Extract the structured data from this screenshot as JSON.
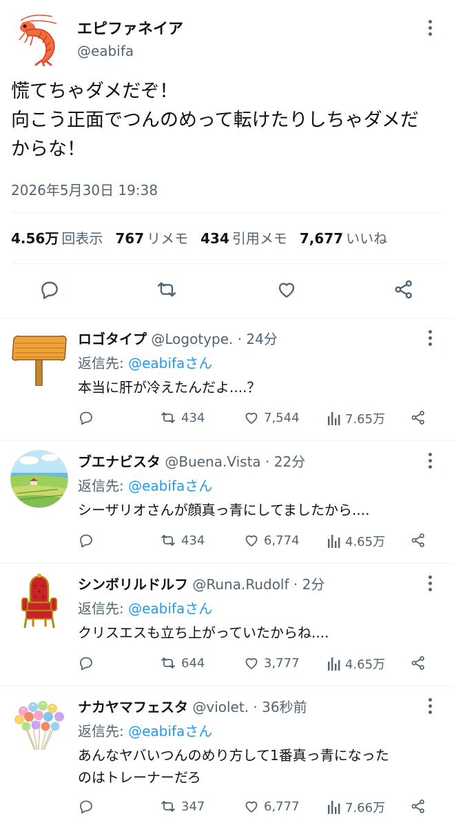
{
  "main_tweet": {
    "author_name": "エピファネイア",
    "author_handle": "@eabifa",
    "text_lines": [
      "慌てちゃダメだぞ！",
      "向こう正面でつんのめって転けたりしちゃダメだ",
      "からな！"
    ],
    "timestamp": "2026年5月30日 19:38",
    "stats": {
      "views_value": "4.56万",
      "views_label": "回表示",
      "reposts_value": "767",
      "reposts_label": "リメモ",
      "quotes_value": "434",
      "quotes_label": "引用メモ",
      "likes_value": "7,677",
      "likes_label": "いいね"
    },
    "actions": [
      "reply-icon",
      "repost-icon",
      "like-icon",
      "share-icon"
    ]
  },
  "replies": [
    {
      "name": "ロゴタイプ",
      "meta": "@Logotype. · 24分",
      "to_prefix": "返信先:",
      "to_mention": "@eabifaさん",
      "text_lines": [
        "本当に肝が冷えたんだよ....？"
      ],
      "reposts": "434",
      "likes": "7,544",
      "views": "7.65万"
    },
    {
      "name": "ブエナビスタ",
      "meta": "@Buena.Vista · 22分",
      "to_prefix": "返信先:",
      "to_mention": "@eabifaさん",
      "text_lines": [
        "シーザリオさんが顔真っ青にしてましたから...."
      ],
      "reposts": "434",
      "likes": "6,774",
      "views": "4.65万"
    },
    {
      "name": "シンボリルドルフ",
      "meta": "@Runa.Rudolf · 2分",
      "to_prefix": "返信先:",
      "to_mention": "@eabifaさん",
      "text_lines": [
        "クリスエスも立ち上がっていたからね...."
      ],
      "reposts": "644",
      "likes": "3,777",
      "views": "4.65万"
    },
    {
      "name": "ナカヤマフェスタ",
      "meta": "@violet. · 36秒前",
      "to_prefix": "返信先:",
      "to_mention": "@eabifaさん",
      "text_lines": [
        "あんなヤバいつんのめり方して1番真っ青になった",
        "のはトレーナーだろ"
      ],
      "reposts": "347",
      "likes": "6,777",
      "views": "7.66万"
    }
  ],
  "colors": {
    "accent": "#1d9bf0",
    "text": "#0f1419",
    "muted": "#536471",
    "border": "#eff3f4"
  }
}
